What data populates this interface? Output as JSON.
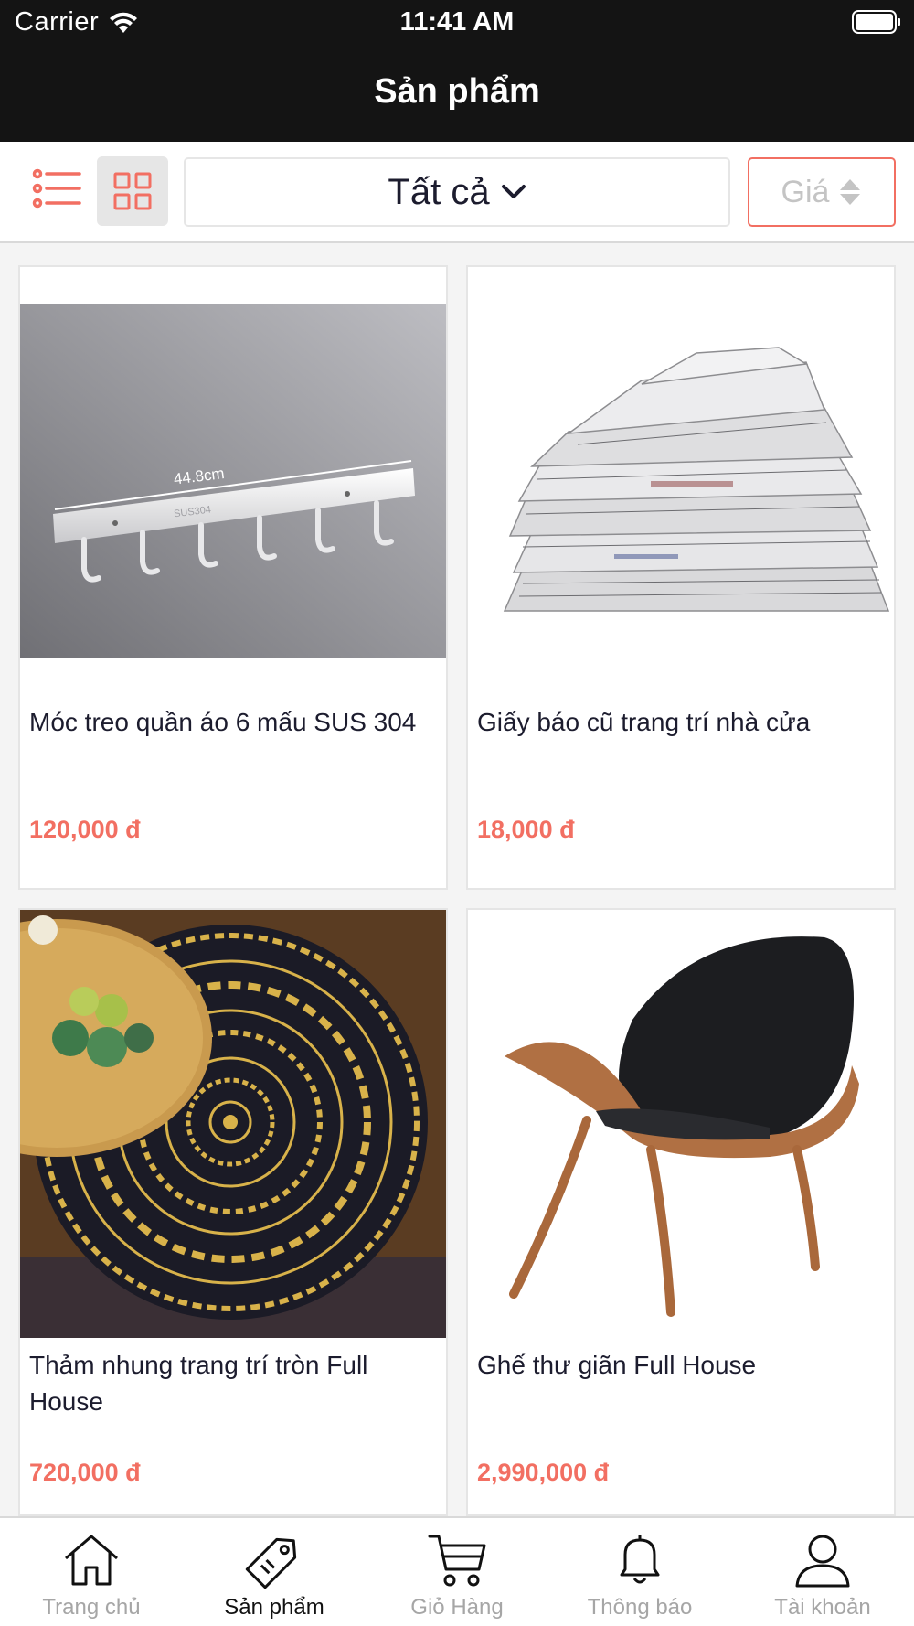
{
  "status_bar": {
    "carrier": "Carrier",
    "time": "11:41 AM"
  },
  "header": {
    "title": "Sản phẩm"
  },
  "toolbar": {
    "filter_label": "Tất cả",
    "sort_label": "Giá",
    "accent_color": "#f26f62"
  },
  "products": [
    {
      "name": "Móc treo quần áo 6 mấu SUS 304",
      "price": "120,000 đ",
      "image": "stainless-coat-hook-rack"
    },
    {
      "name": "Giấy báo cũ trang trí nhà cửa",
      "price": "18,000 đ",
      "image": "newspaper-stack"
    },
    {
      "name": "Thảm nhung trang trí tròn Full House",
      "price": "720,000 đ",
      "image": "round-mandala-rug"
    },
    {
      "name": "Ghế thư giãn Full House",
      "price": "2,990,000 đ",
      "image": "shell-lounge-chair"
    }
  ],
  "product_image_text": {
    "ruler_label": "44.8cm",
    "engraving": "SUS304"
  },
  "tabs": [
    {
      "label": "Trang chủ",
      "icon": "home-icon",
      "active": false
    },
    {
      "label": "Sản phẩm",
      "icon": "tag-icon",
      "active": true
    },
    {
      "label": "Giỏ Hàng",
      "icon": "cart-icon",
      "active": false
    },
    {
      "label": "Thông báo",
      "icon": "bell-icon",
      "active": false
    },
    {
      "label": "Tài khoản",
      "icon": "user-icon",
      "active": false
    }
  ]
}
